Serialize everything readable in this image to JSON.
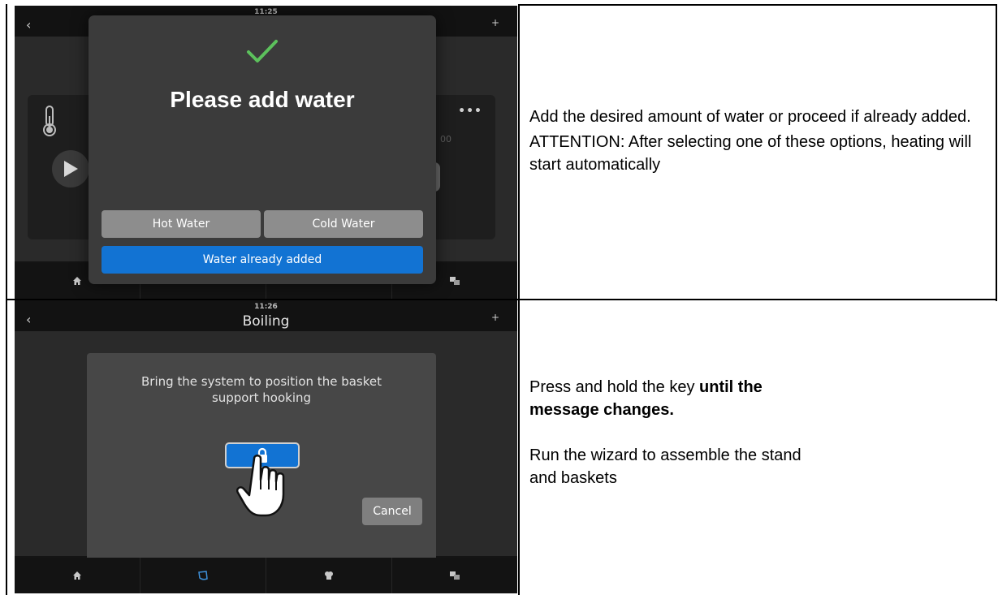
{
  "step1": {
    "screen": {
      "clock": "11:25",
      "dialog": {
        "title": "Please add water",
        "hot_water_label": "Hot Water",
        "cold_water_label": "Cold Water",
        "water_added_label": "Water already added"
      },
      "background_time_fragment": "00"
    },
    "instruction": {
      "line1": "Add the desired amount of water or proceed if already added.",
      "line2": "ATTENTION: After selecting one of these options, heating will start automatically"
    }
  },
  "step2": {
    "screen": {
      "clock": "11:26",
      "title": "Boiling",
      "dialog": {
        "message": "Bring the system to position the basket support hooking",
        "cancel_label": "Cancel"
      }
    },
    "instruction": {
      "line1_plain": "Press and hold the key ",
      "line1_bold": "until the message changes.",
      "line2": "Run the wizard to assemble the stand and baskets"
    }
  },
  "colors": {
    "accent_blue": "#1273d3",
    "check_green": "#5cc15c",
    "dialog_gray_button": "#8d8d8d"
  }
}
